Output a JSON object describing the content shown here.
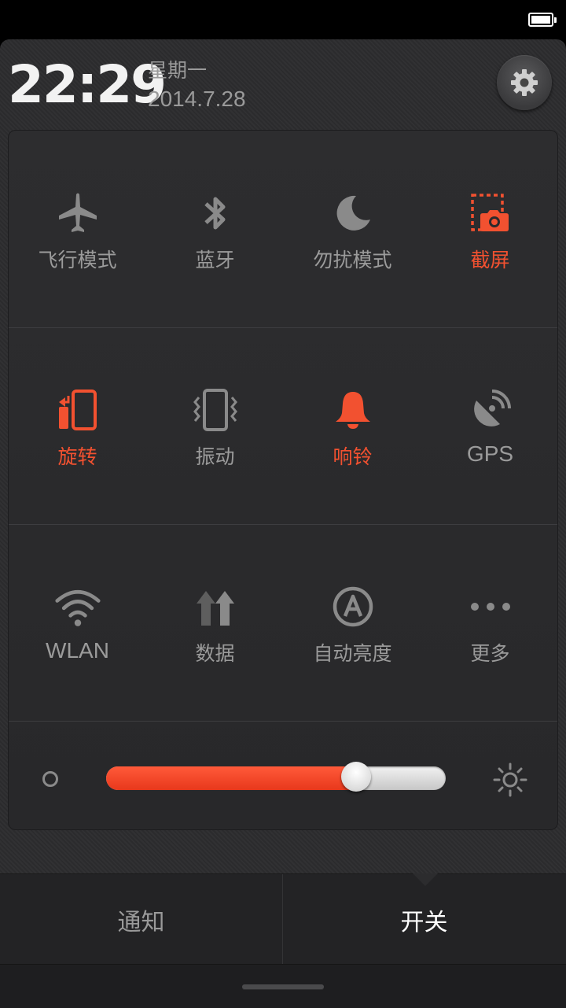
{
  "status_bar": {
    "battery_level": 1.0
  },
  "header": {
    "time": "22:29",
    "weekday": "星期一",
    "date": "2014.7.28",
    "settings_icon": "gear-icon"
  },
  "toggles": [
    {
      "id": "airplane",
      "label": "飞行模式",
      "icon": "airplane-icon",
      "on": false
    },
    {
      "id": "bluetooth",
      "label": "蓝牙",
      "icon": "bluetooth-icon",
      "on": false
    },
    {
      "id": "dnd",
      "label": "勿扰模式",
      "icon": "moon-icon",
      "on": false
    },
    {
      "id": "screenshot",
      "label": "截屏",
      "icon": "screenshot-icon",
      "on": true
    },
    {
      "id": "rotate",
      "label": "旋转",
      "icon": "rotate-icon",
      "on": true
    },
    {
      "id": "vibrate",
      "label": "振动",
      "icon": "vibrate-icon",
      "on": false
    },
    {
      "id": "ring",
      "label": "响铃",
      "icon": "bell-icon",
      "on": true
    },
    {
      "id": "gps",
      "label": "GPS",
      "icon": "gps-icon",
      "on": false
    },
    {
      "id": "wlan",
      "label": "WLAN",
      "icon": "wifi-icon",
      "on": false
    },
    {
      "id": "data",
      "label": "数据",
      "icon": "data-icon",
      "on": false
    },
    {
      "id": "auto_brightness",
      "label": "自动亮度",
      "icon": "auto-brightness-icon",
      "on": false
    },
    {
      "id": "more",
      "label": "更多",
      "icon": "more-icon",
      "on": false
    }
  ],
  "brightness": {
    "level": 0.735
  },
  "tabs": [
    {
      "label": "通知",
      "active": false
    },
    {
      "label": "开关",
      "active": true
    }
  ],
  "colors": {
    "accent": "#f25130",
    "inactive": "#8a8a8a"
  }
}
